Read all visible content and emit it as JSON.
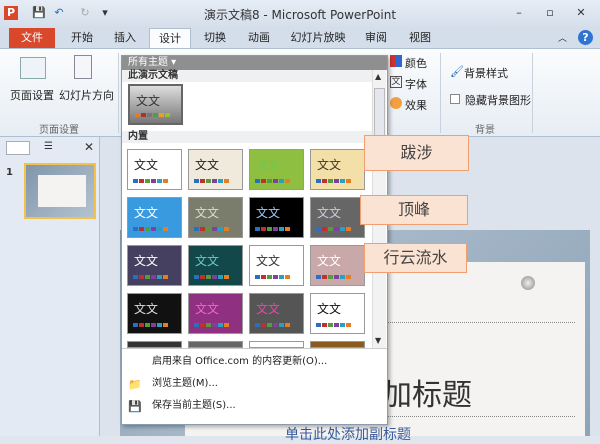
{
  "window": {
    "title": "演示文稿8 - Microsoft PowerPoint"
  },
  "tabs": [
    {
      "label": "文件"
    },
    {
      "label": "开始"
    },
    {
      "label": "插入"
    },
    {
      "label": "设计"
    },
    {
      "label": "切换"
    },
    {
      "label": "动画"
    },
    {
      "label": "幻灯片放映"
    },
    {
      "label": "审阅"
    },
    {
      "label": "视图"
    }
  ],
  "ribbon": {
    "page_setup": "页面设置",
    "orientation": "幻灯片方向",
    "group_page_setup": "页面设置",
    "colors": "颜色",
    "fonts": "字体",
    "effects": "效果",
    "bg_styles": "背景样式",
    "hide_bg": "隐藏背景图形",
    "group_background": "背景"
  },
  "gallery": {
    "header": "所有主题 ▾",
    "section_current": "此演示文稿",
    "section_builtin": "内置",
    "thumb_text": "文文",
    "menu": [
      "启用来自 Office.com 的内容更新(O)...",
      "浏览主题(M)...",
      "保存当前主题(S)..."
    ]
  },
  "callouts": [
    "跋涉",
    "顶峰",
    "行云流水"
  ],
  "slide": {
    "title": "加标题",
    "subtitle": "单击此处添加副标题",
    "number": "1"
  }
}
